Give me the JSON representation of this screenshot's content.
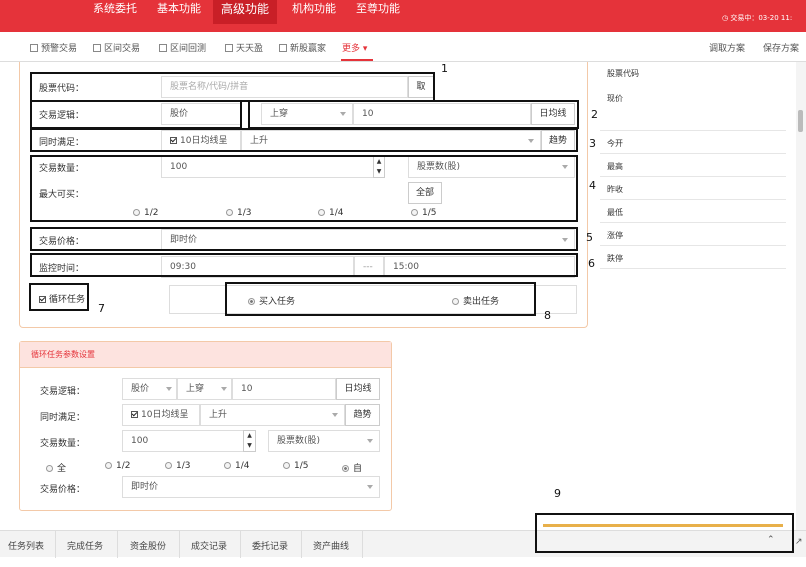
{
  "top_nav": {
    "items": [
      "系统委托",
      "基本功能",
      "高级功能",
      "机构功能",
      "至尊功能"
    ],
    "status": "交易中：03-20 11:"
  },
  "sub_nav": {
    "items": [
      "预警交易",
      "区间交易",
      "区间回测",
      "天天盈",
      "新股赢家",
      "更多"
    ],
    "load_scheme": "调取方案",
    "save_scheme": "保存方案"
  },
  "form": {
    "stock_code_label": "股票代码：",
    "stock_code_placeholder": "股票名称/代码/拼音",
    "stock_code_button": "取",
    "logic_label": "交易逻辑：",
    "logic_value": "股价",
    "logic_direction": "上穿",
    "logic_days": "10",
    "logic_unit": "日均线",
    "condition_label": "同时满足：",
    "condition_check": "10日均线呈",
    "condition_value": "上升",
    "condition_unit": "趋势",
    "quantity_label": "交易数量：",
    "quantity_value": "100",
    "quantity_unit": "股票数(股)",
    "max_buy_label": "最大可买：",
    "all_button": "全部",
    "fractions": [
      "1/2",
      "1/3",
      "1/4",
      "1/5"
    ],
    "price_label": "交易价格：",
    "price_value": "即时价",
    "monitor_label": "监控时间：",
    "monitor_start": "09:30",
    "monitor_sep": "---",
    "monitor_end": "15:00",
    "loop_label": "循环任务",
    "buy_task": "买入任务",
    "sell_task": "卖出任务"
  },
  "quote_panel": {
    "rows": [
      "股票代码",
      "现价",
      "今开",
      "最高",
      "昨收",
      "最低",
      "涨停",
      "跌停"
    ]
  },
  "loop_panel": {
    "title": "循环任务参数设置",
    "logic_label": "交易逻辑：",
    "logic_value": "股价",
    "logic_direction": "上穿",
    "logic_days": "10",
    "logic_unit": "日均线",
    "condition_label": "同时满足：",
    "condition_check": "10日均线呈",
    "condition_value": "上升",
    "condition_unit": "趋势",
    "quantity_label": "交易数量：",
    "quantity_value": "100",
    "quantity_unit": "股票数(股)",
    "fractions": [
      "全",
      "1/2",
      "1/3",
      "1/4",
      "1/5",
      "自"
    ],
    "price_label": "交易价格：",
    "price_value": "即时价"
  },
  "bottom_tabs": [
    "任务列表",
    "完成任务",
    "资金股份",
    "成交记录",
    "委托记录",
    "资产曲线"
  ],
  "annotations": [
    "1",
    "2",
    "3",
    "4",
    "5",
    "6",
    "7",
    "8",
    "9"
  ],
  "colors": {
    "accent": "#e5333a",
    "panel_border": "#f3c9a8",
    "panel_header": "#fde3df",
    "progress": "#e8b04a"
  }
}
